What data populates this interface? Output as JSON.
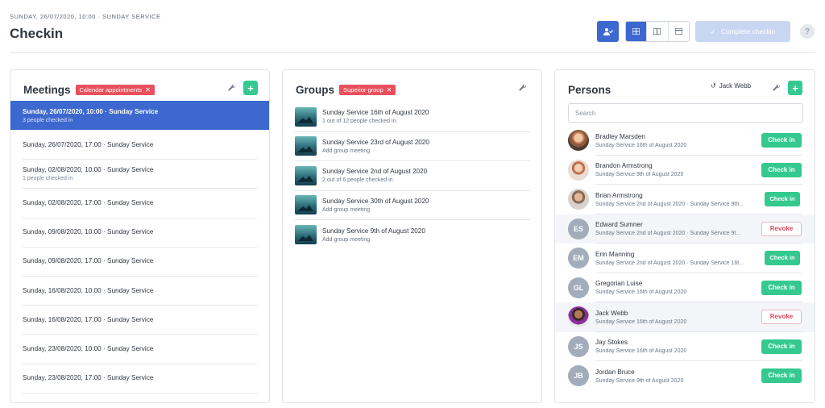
{
  "header": {
    "eyebrow": "SUNDAY, 26/07/2020, 10:00 · SUNDAY SERVICE",
    "title": "Checkin",
    "complete_label": "Complete checkin",
    "help_label": "?"
  },
  "colors": {
    "primary": "#3c68cf",
    "success": "#34c98e",
    "danger": "#ea4f5c"
  },
  "meetings": {
    "title": "Meetings",
    "tag": "Calendar appointments",
    "items": [
      {
        "title": "Sunday, 26/07/2020, 10:00 · Sunday Service",
        "sub": "3 people checked in"
      },
      {
        "title": "Sunday, 26/07/2020, 17:00 · Sunday Service",
        "sub": ""
      },
      {
        "title": "Sunday, 02/08/2020, 10:00 · Sunday Service",
        "sub": "1 people checked in"
      },
      {
        "title": "Sunday, 02/08/2020, 17:00 · Sunday Service",
        "sub": ""
      },
      {
        "title": "Sunday, 09/08/2020, 10:00 · Sunday Service",
        "sub": ""
      },
      {
        "title": "Sunday, 09/08/2020, 17:00 · Sunday Service",
        "sub": ""
      },
      {
        "title": "Sunday, 16/08/2020, 10:00 · Sunday Service",
        "sub": ""
      },
      {
        "title": "Sunday, 16/08/2020, 17:00 · Sunday Service",
        "sub": ""
      },
      {
        "title": "Sunday, 23/08/2020, 10:00 · Sunday Service",
        "sub": ""
      },
      {
        "title": "Sunday, 23/08/2020, 17:00 · Sunday Service",
        "sub": ""
      }
    ]
  },
  "groups": {
    "title": "Groups",
    "tag": "Superior group",
    "items": [
      {
        "title": "Sunday Service 16th of August 2020",
        "sub": "1 out of 12 people checked in."
      },
      {
        "title": "Sunday Service 23rd of August 2020",
        "sub": "Add group meeting"
      },
      {
        "title": "Sunday Service 2nd of August 2020",
        "sub": "2 out of 6 people checked in."
      },
      {
        "title": "Sunday Service 30th of August 2020",
        "sub": "Add group meeting"
      },
      {
        "title": "Sunday Service 9th of August 2020",
        "sub": "Add group meeting"
      }
    ]
  },
  "persons": {
    "title": "Persons",
    "user_filter": "Jack Webb",
    "search_placeholder": "Search",
    "items": [
      {
        "name": "Bradley Marsden",
        "sub": "Sunday Service 16th of August 2020",
        "initials": "",
        "action": "Check in"
      },
      {
        "name": "Brandon Armstrong",
        "sub": "Sunday Service 9th of August 2020",
        "initials": "",
        "action": "Check in"
      },
      {
        "name": "Brian Armstrong",
        "sub": "Sunday Service 2nd of August 2020 · Sunday Service 9th...",
        "initials": "",
        "action": "Check in"
      },
      {
        "name": "Edward Sumner",
        "sub": "Sunday Service 2nd of August 2020 · Sunday Service 9t...",
        "initials": "ES",
        "action": "Revoke"
      },
      {
        "name": "Erin Manning",
        "sub": "Sunday Service 2nd of August 2020 · Sunday Service 16t...",
        "initials": "EM",
        "action": "Check in"
      },
      {
        "name": "Gregorian Luise",
        "sub": "Sunday Service 16th of August 2020",
        "initials": "GL",
        "action": "Check in"
      },
      {
        "name": "Jack Webb",
        "sub": "Sunday Service 16th of August 2020",
        "initials": "",
        "action": "Revoke"
      },
      {
        "name": "Jay Stokes",
        "sub": "Sunday Service 16th of August 2020",
        "initials": "JS",
        "action": "Check in"
      },
      {
        "name": "Jordan Bruce",
        "sub": "Sunday Service 9th of August 2020",
        "initials": "JB",
        "action": "Check in"
      }
    ]
  }
}
